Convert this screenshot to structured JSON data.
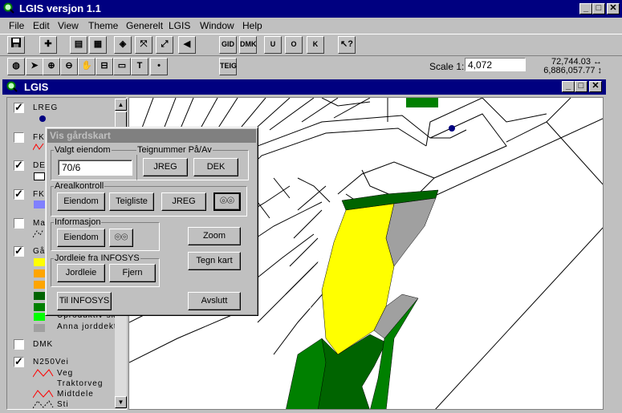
{
  "app": {
    "title": "LGIS versjon 1.1",
    "window_buttons": [
      "_",
      "□",
      "✕"
    ]
  },
  "menu": [
    "File",
    "Edit",
    "View",
    "Theme",
    "Generelt",
    "LGIS",
    "Window",
    "Help"
  ],
  "toolbar1": {
    "gid_label": "GID",
    "dmk_label": "DMK",
    "u_label": "U",
    "o_label": "O",
    "k_label": "K"
  },
  "toolbar2": {
    "teig_label": "TEIG",
    "scale_label": "Scale 1:",
    "scale_value": "4,072",
    "coord_x": "72,744.03",
    "coord_y": "6,886,057.77",
    "coord_x_arrow": "↔",
    "coord_y_arrow": "↕"
  },
  "child": {
    "title": "LGIS"
  },
  "legend": {
    "themes": [
      {
        "name": "LREG",
        "checked": true
      },
      {
        "name": "FK",
        "checked": false
      },
      {
        "name": "DE",
        "checked": true
      },
      {
        "name": "FK",
        "checked": true
      },
      {
        "name": "Ma",
        "checked": false
      },
      {
        "name": "Gå",
        "checked": true
      },
      {
        "name": "DMK",
        "checked": false
      },
      {
        "name": "N250Vei",
        "checked": true
      }
    ],
    "garden_items": [
      "Uproduktiv sk",
      "Anna jorddekt"
    ],
    "vei_items": [
      "Veg",
      "Traktorveg",
      "Midtdele",
      "Sti"
    ],
    "colors": {
      "lreg_point": "#000080",
      "de_fill": "#ffffff",
      "fk_fill": "#8080ff",
      "yellow": "#ffff00",
      "orange": "#ffa500",
      "dark_green": "#006400",
      "green": "#008000",
      "bright_green": "#00ff00",
      "grey": "#a0a0a0",
      "road": "#ff0000"
    }
  },
  "dialog": {
    "title": "Vis gårdskart",
    "valgt_eiendom": {
      "label": "Valgt eiendom",
      "value": "70/6"
    },
    "teignummer": {
      "label": "Teignummer På/Av",
      "jreg": "JREG",
      "dek": "DEK"
    },
    "arealkontroll": {
      "label": "Arealkontroll",
      "eiendom": "Eiendom",
      "teigliste": "Teigliste",
      "jreg": "JREG"
    },
    "informasjon": {
      "label": "Informasjon",
      "eiendom": "Eiendom"
    },
    "jordleie": {
      "label": "Jordleie fra INFOSYS",
      "jordleie": "Jordleie",
      "fjern": "Fjern"
    },
    "zoom": "Zoom",
    "tegn_kart": "Tegn kart",
    "til_infosys": "Til INFOSYS",
    "avslutt": "Avslutt"
  }
}
